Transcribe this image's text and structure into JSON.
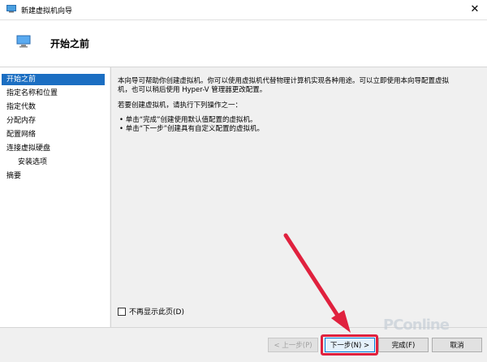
{
  "window": {
    "title": "新建虚拟机向导",
    "close_glyph": "✕"
  },
  "header": {
    "title": "开始之前"
  },
  "sidebar": {
    "items": [
      {
        "label": "开始之前",
        "active": true,
        "sub": false
      },
      {
        "label": "指定名称和位置",
        "active": false,
        "sub": false
      },
      {
        "label": "指定代数",
        "active": false,
        "sub": false
      },
      {
        "label": "分配内存",
        "active": false,
        "sub": false
      },
      {
        "label": "配置网络",
        "active": false,
        "sub": false
      },
      {
        "label": "连接虚拟硬盘",
        "active": false,
        "sub": false
      },
      {
        "label": "安装选项",
        "active": false,
        "sub": true
      },
      {
        "label": "摘要",
        "active": false,
        "sub": false
      }
    ]
  },
  "content": {
    "intro_line1": "本向导可帮助你创建虚拟机。你可以使用虚拟机代替物理计算机实现各种用途。可以立即使用本向导配置虚拟",
    "intro_line2": "机，也可以稍后使用 Hyper-V 管理器更改配置。",
    "prompt": "若要创建虚拟机，请执行下列操作之一：",
    "bullet1": "• 单击“完成”创建使用默认值配置的虚拟机。",
    "bullet2": "• 单击“下一步”创建具有自定义配置的虚拟机。",
    "checkbox_label": "不再显示此页(D)"
  },
  "footer": {
    "prev_label": "< 上一步(P)",
    "next_label": "下一步(N) >",
    "finish_label": "完成(F)",
    "cancel_label": "取消"
  },
  "watermark": "PConline",
  "colors": {
    "accent": "#1b6ec2",
    "highlight": "#e0213e"
  }
}
